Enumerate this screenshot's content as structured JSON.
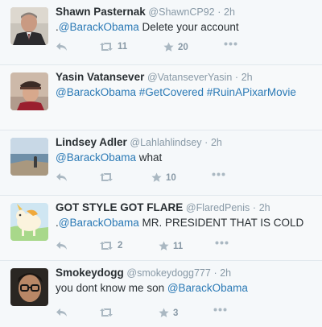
{
  "tweets": [
    {
      "name": "Shawn Pasternak",
      "handle": "@ShawnCP92",
      "sep": "·",
      "time": "2h",
      "text_prefix": ".",
      "mention": "@BarackObama",
      "text_rest": " Delete your account",
      "retweets": "11",
      "favorites": "20",
      "avatar": "avatar-portrait-suit"
    },
    {
      "name": "Yasin Vatansever",
      "handle": "@VatanseverYasin",
      "sep": "·",
      "time": "2h",
      "text_prefix": "",
      "mention": "@BarackObama",
      "text_rest": " #GetCovered #RuinAPixarMovie",
      "retweets": "",
      "favorites": "",
      "avatar": "avatar-young-man-cap"
    },
    {
      "name": "Lindsey Adler",
      "handle": "@Lahlahlindsey",
      "sep": "·",
      "time": "2h",
      "text_prefix": "",
      "mention": "@BarackObama",
      "text_rest": " what",
      "retweets": "",
      "favorites": "10",
      "avatar": "avatar-seaside-landscape"
    },
    {
      "name": "GOT STYLE GOT FLARE",
      "handle": "@FlaredPenis",
      "sep": "·",
      "time": "2h",
      "text_prefix": ".",
      "mention": "@BarackObama",
      "text_rest": " MR. PRESIDENT THAT IS COLD",
      "retweets": "2",
      "favorites": "11",
      "avatar": "avatar-cartoon-unicorn"
    },
    {
      "name": "Smokeydogg",
      "handle": "@smokeydogg777",
      "sep": "·",
      "time": "2h",
      "text_prefix": "",
      "mention": "",
      "text_rest": "you dont know me son ",
      "mention_end": "@BarackObama",
      "retweets": "",
      "favorites": "3",
      "avatar": "avatar-selfie-glasses"
    }
  ],
  "icons": {
    "reply": "reply-icon",
    "retweet": "retweet-icon",
    "favorite": "star-icon",
    "more": "more-icon"
  },
  "colors": {
    "link": "#2a79b5",
    "meta": "#8899a6",
    "text": "#292f33"
  }
}
